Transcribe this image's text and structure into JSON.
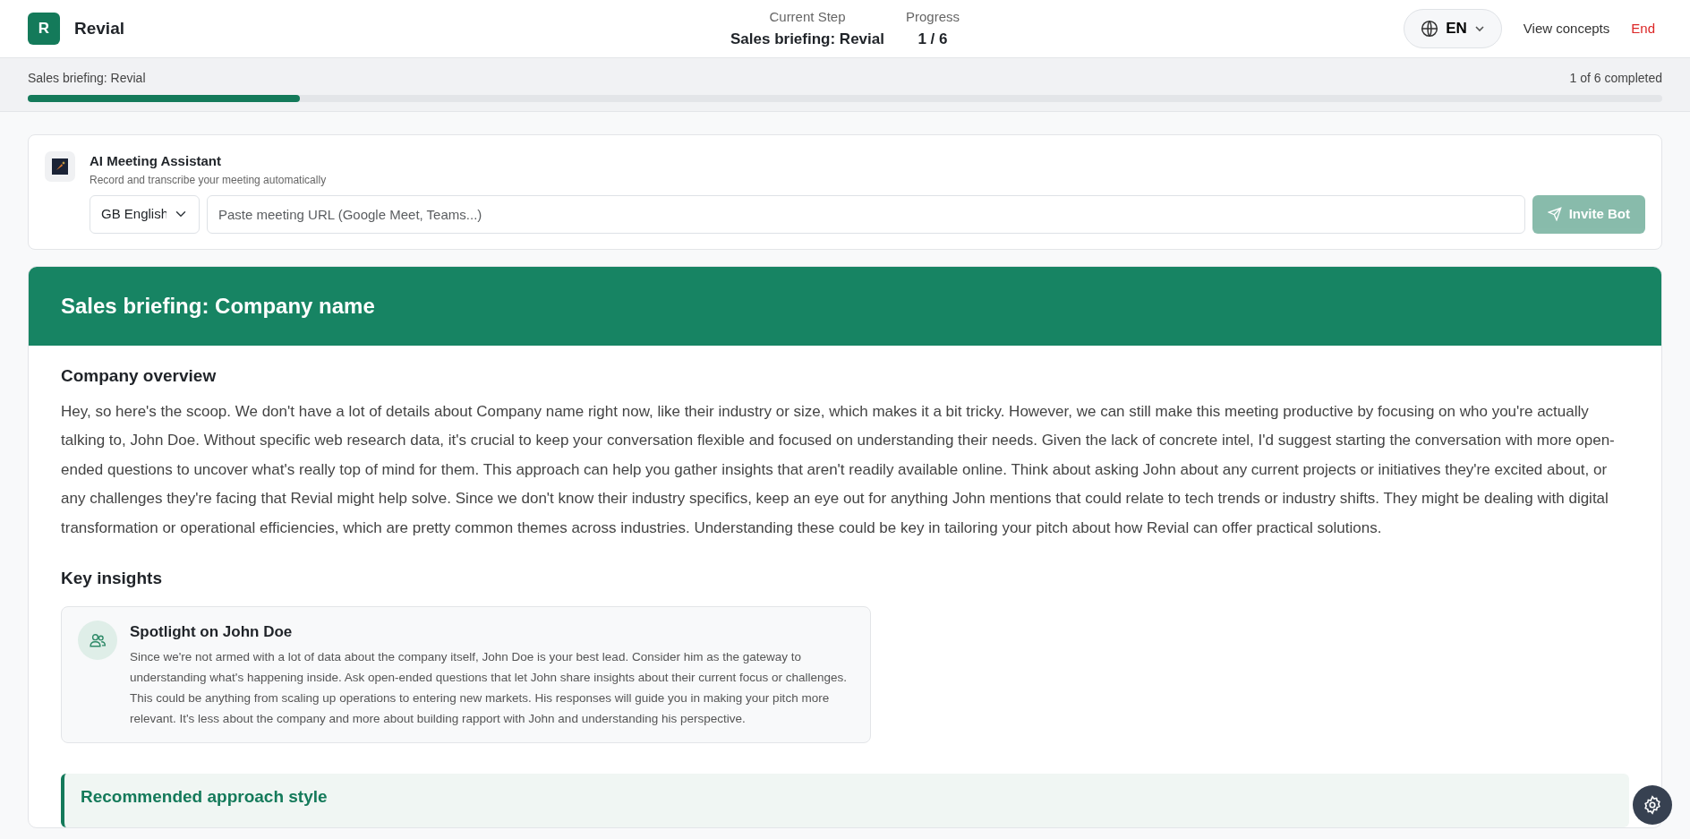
{
  "header": {
    "logo_letter": "R",
    "app_name": "Revial",
    "current_step_label": "Current Step",
    "current_step": "Sales briefing: Revial",
    "progress_label": "Progress",
    "progress": "1 / 6",
    "language": "EN",
    "links": [
      "View concepts",
      "End"
    ]
  },
  "progress_bar": {
    "title": "Sales briefing: Revial",
    "summary": "1 of 6 completed",
    "level": 0.1667
  },
  "meeting_assistant": {
    "title": "AI Meeting Assistant",
    "subtitle": "Record and transcribe your meeting automatically",
    "language_flag": "GB",
    "language": "English",
    "url_placeholder": "Paste meeting URL (Google Meet, Teams...)",
    "button": {
      "label": "Invite Bot",
      "disabled": true
    }
  },
  "briefing": {
    "title": "Sales briefing: Company name",
    "overview_heading": "Company overview",
    "overview": "Hey, so here's the scoop. We don't have a lot of details about Company name right now, like their industry or size, which makes it a bit tricky. However, we can still make this meeting productive by focusing on who you're actually talking to, John Doe. Without specific web research data, it's crucial to keep your conversation flexible and focused on understanding their needs. Given the lack of concrete intel, I'd suggest starting the conversation with more open-ended questions to uncover what's really top of mind for them. This approach can help you gather insights that aren't readily available online. Think about asking John about any current projects or initiatives they're excited about, or any challenges they're facing that Revial might help solve. Since we don't know their industry specifics, keep an eye out for anything John mentions that could relate to tech trends or industry shifts. They might be dealing with digital transformation or operational efficiencies, which are pretty common themes across industries. Understanding these could be key in tailoring your pitch about how Revial can offer practical solutions.",
    "insights_heading": "Key insights",
    "insights": [
      {
        "title": "Spotlight on John Doe",
        "text": "Since we're not armed with a lot of data about the company itself, John Doe is your best lead. Consider him as the gateway to understanding what's happening inside. Ask open-ended questions that let John share insights about their current focus or challenges. This could be anything from scaling up operations to entering new markets. His responses will guide you in making your pitch more relevant. It's less about the company and more about building rapport with John and understanding his perspective."
      }
    ],
    "approach_heading": "Recommended approach style"
  }
}
